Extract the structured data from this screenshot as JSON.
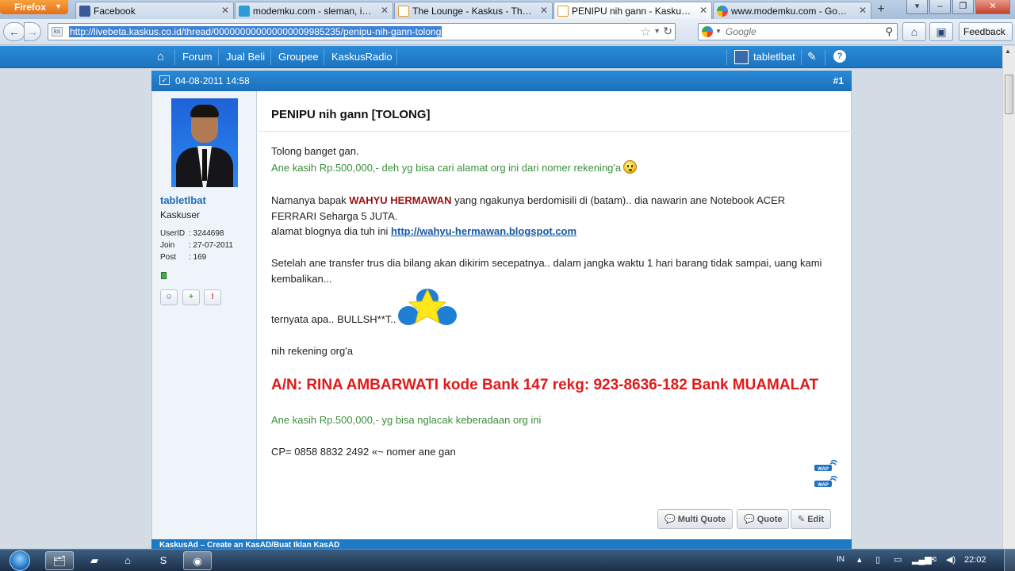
{
  "browser": {
    "app_button": "Firefox",
    "tabs": [
      {
        "title": "Facebook",
        "color": "#3b5998",
        "active": false
      },
      {
        "title": "modemku.com - sleman, indo...",
        "color": "#2d9cd7",
        "active": false
      },
      {
        "title": "The Lounge - Kaskus - The Lar...",
        "color": "#ffffff",
        "active": false
      },
      {
        "title": "PENIPU nih gann - Kaskus - T...",
        "color": "#ffffff",
        "active": true
      },
      {
        "title": "www.modemku.com - Google...",
        "color": "#4285f4",
        "active": false
      }
    ],
    "url": "http://livebeta.kaskus.co.id/thread/000000000000000009985235/penipu-nih-gann-tolong",
    "search_placeholder": "Google",
    "feedback_label": "Feedback"
  },
  "site_nav": {
    "links": [
      "Forum",
      "Jual Beli",
      "Groupee",
      "KaskusRadio"
    ],
    "username": "tabletlbat"
  },
  "post": {
    "date": "04-08-2011 14:58",
    "number": "#1",
    "title": "PENIPU nih gann [TOLONG]",
    "line1": "Tolong banget gan.",
    "line2": "Ane kasih Rp.500,000,- deh yg bisa cari alamat org ini dari nomer rekening'a",
    "para2_before": "Namanya bapak ",
    "para2_name": "WAHYU HERMAWAN",
    "para2_after": " yang ngakunya berdomisili di (batam).. dia nawarin ane Notebook ACER",
    "para2_line2": "FERRARI Seharga 5 JUTA.",
    "blog_before": "alamat blognya dia tuh ini ",
    "blog_link": "http://wahyu-hermawan.blogspot.com",
    "para3_line1": "Setelah ane transfer trus dia bilang akan dikirim secepatnya.. dalam jangka waktu 1 hari barang tidak sampai, uang kami",
    "para3_line2": "kembalikan...",
    "bullsh": "ternyata apa.. BULLSH**T.. ?",
    "rekening": "nih rekening org'a",
    "account": "A/N: RINA AMBARWATI kode Bank 147 rekg: 923-8636-182 Bank MUAMALAT",
    "reward": "Ane kasih Rp.500,000,- yg bisa nglacak keberadaan org ini",
    "cp": "CP= 0858 8832 2492 «~ nomer ane gan",
    "buttons": {
      "multi_quote": "Multi Quote",
      "quote": "Quote",
      "edit": "Edit"
    }
  },
  "author": {
    "username": "tabletlbat",
    "rank": "Kaskuser",
    "userid_label": "UserID",
    "userid": ": 3244698",
    "join_label": "Join",
    "join": ": 27-07-2011",
    "post_label": "Post",
    "posts": ": 169"
  },
  "kaskusad": "KaskusAd – Create an KasAD/Buat Iklan KasAD",
  "taskbar": {
    "lang": "IN",
    "clock": "22:02"
  }
}
